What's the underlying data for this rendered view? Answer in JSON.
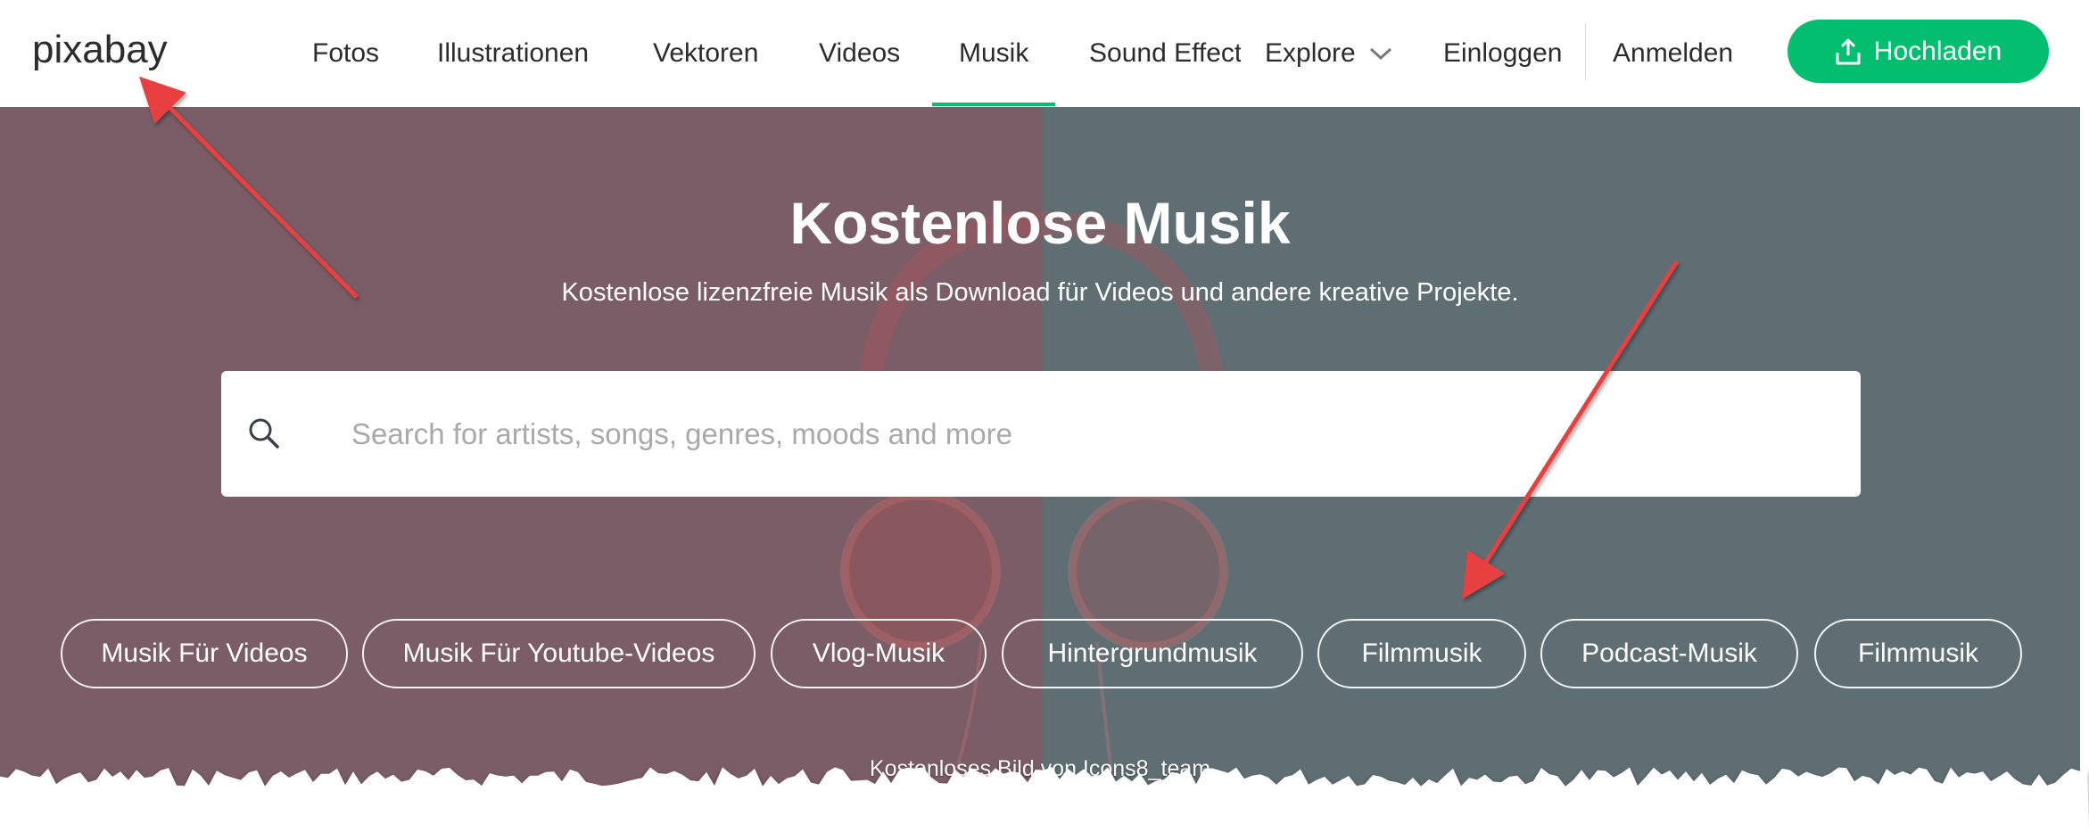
{
  "brand": {
    "logo_text": "pixabay"
  },
  "nav": {
    "items": [
      "Fotos",
      "Illustrationen",
      "Vektoren",
      "Videos",
      "Musik",
      "Sound Effects"
    ],
    "active": "Musik",
    "explore_label": "Explore",
    "login_label": "Einloggen",
    "signup_label": "Anmelden",
    "upload_label": "Hochladen"
  },
  "hero": {
    "title": "Kostenlose Musik",
    "subtitle": "Kostenlose lizenzfreie Musik als Download für Videos und andere kreative Projekte.",
    "search_placeholder": "Search for artists, songs, genres, moods and more",
    "search_value": "",
    "tags": [
      "Musik Für Videos",
      "Musik Für Youtube-Videos",
      "Vlog-Musik",
      "Hintergrundmusik",
      "Filmmusik",
      "Podcast-Musik",
      "Filmmusik"
    ],
    "credit": "Kostenloses Bild von Icons8_team"
  },
  "colors": {
    "accent": "#02be6e",
    "hero_left": "#7a5d66",
    "hero_right": "#5f6e73",
    "annotation_arrow": "#e84040"
  },
  "icons": [
    "chevron-down-icon",
    "upload-icon",
    "search-icon"
  ]
}
